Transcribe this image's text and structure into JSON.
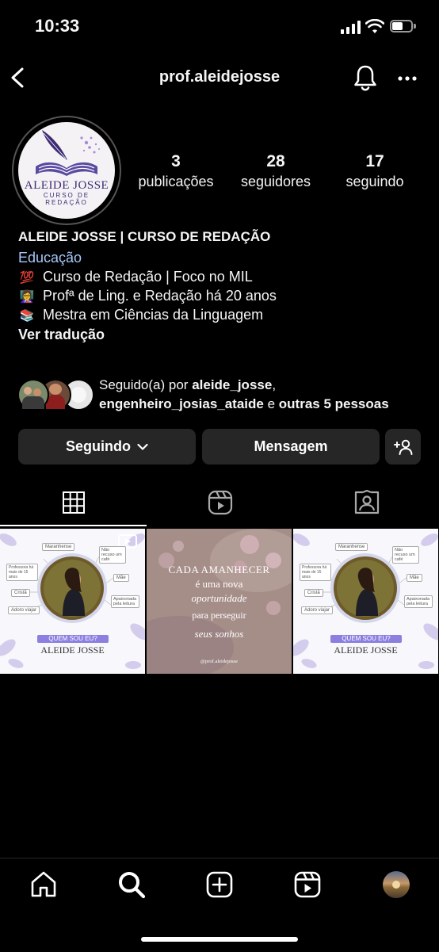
{
  "status_bar": {
    "time": "10:33"
  },
  "header": {
    "username": "prof.aleidejosse"
  },
  "profile": {
    "logo_text": "ALEIDE JOSSE",
    "logo_sub1": "CURSO DE",
    "logo_sub2": "REDAÇÃO",
    "stats": [
      {
        "value": "3",
        "label": "publicações"
      },
      {
        "value": "28",
        "label": "seguidores"
      },
      {
        "value": "17",
        "label": "seguindo"
      }
    ],
    "name": "ALEIDE JOSSE | CURSO DE REDAÇÃO",
    "category": "Educação",
    "bio_lines": [
      {
        "emoji": "💯",
        "text": "Curso de Redação | Foco no MIL"
      },
      {
        "emoji": "👩‍🏫",
        "text": "Profª de Ling. e Redação há 20 anos"
      },
      {
        "emoji": "📚",
        "text": "Mestra em Ciências da Linguagem"
      }
    ],
    "translate": "Ver tradução",
    "followed_by": {
      "prefix": "Seguido(a) por ",
      "user1": "aleide_josse",
      "sep": ",",
      "user2": "engenheiro_josias_ataide",
      "mid": " e ",
      "others": "outras 5 pessoas"
    }
  },
  "actions": {
    "following": "Seguindo",
    "message": "Mensagem"
  },
  "posts": [
    {
      "type": "quem-sou-eu",
      "tags": [
        "Maranhense",
        "Não recuso um café",
        "Professora há mais de 15 anos",
        "Mãe",
        "Cristã",
        "Apaixonada pela leitura",
        "Adoro viajar"
      ],
      "banner": "QUEM SOU EU?",
      "name": "ALEIDE JOSSE"
    },
    {
      "type": "quote",
      "line1": "CADA AMANHECER",
      "line2": "é uma nova",
      "line3": "oportunidade",
      "line4": "para perseguir",
      "line5": "seus sonhos",
      "handle": "@prof.aleidejosse"
    },
    {
      "type": "quem-sou-eu",
      "tags": [
        "Maranhense",
        "Não recuso um café",
        "Professora há mais de 15 anos",
        "Mãe",
        "Cristã",
        "Apaixonada pela leitura",
        "Adoro viajar"
      ],
      "banner": "QUEM SOU EU?",
      "name": "ALEIDE JOSSE"
    }
  ],
  "colors": {
    "background": "#000000",
    "button": "#262626",
    "link": "#a8c7fa",
    "accent": "#8b7fe0"
  },
  "icons": [
    "back-icon",
    "bell-icon",
    "more-icon",
    "chevron-down-icon",
    "add-person-icon",
    "grid-icon",
    "reels-icon",
    "tagged-icon",
    "home-icon",
    "search-icon",
    "create-icon",
    "reels-nav-icon",
    "profile-avatar"
  ]
}
